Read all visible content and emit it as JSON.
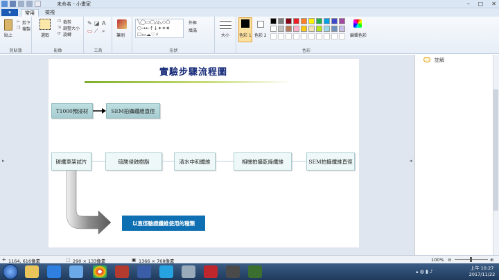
{
  "window": {
    "title": "未命名 - 小畫家"
  },
  "tabs": [
    "常用",
    "檢視"
  ],
  "ribbon": {
    "clipboard": {
      "paste": "貼上",
      "cut": "剪下",
      "copy": "複製",
      "label": "剪貼簿"
    },
    "image": {
      "select": "選取",
      "crop": "裁剪",
      "resize": "調整大小",
      "rotate": "旋轉",
      "label": "影像"
    },
    "tools": {
      "label": "工具"
    },
    "brushes": {
      "label": "筆刷"
    },
    "shapes": {
      "outline": "外框",
      "fill": "填滿",
      "label": "形狀"
    },
    "size": {
      "label": "大小"
    },
    "colors": {
      "color1": "色彩 1",
      "color2": "色彩 2",
      "edit": "編輯色彩",
      "label": "色彩"
    }
  },
  "palette": [
    "#000000",
    "#7f7f7f",
    "#880015",
    "#ed1c24",
    "#ff7f27",
    "#fff200",
    "#22b14c",
    "#00a2e8",
    "#3f48cc",
    "#a349a4",
    "#ffffff",
    "#c3c3c3",
    "#b97a57",
    "#ffaec9",
    "#ffc90e",
    "#efe4b0",
    "#b5e61d",
    "#99d9ea",
    "#7092be",
    "#c8bfe7"
  ],
  "diagram": {
    "title": "實驗步驟流程圖",
    "step_a1": "T1000預浸材",
    "step_a2": "SEM拍攝纖維直徑",
    "step_b1": "碳纖車架試片",
    "step_b2": "硫酸侵蝕樹脂",
    "step_b3": "清水中和纖維",
    "step_b4": "相機拍攝乾燥纖維",
    "step_b5": "SEM拍攝纖維直徑",
    "result": "以直徑驗證纖維使用的種類"
  },
  "side_panel": {
    "comments_label": "註解"
  },
  "status": {
    "cursor": "1164, 616像素",
    "selection": "290 × 133像素",
    "image_size": "1366 × 768像素",
    "zoom": "100%"
  },
  "clock": {
    "time": "上午 10:27",
    "date": "2017/11/22"
  }
}
